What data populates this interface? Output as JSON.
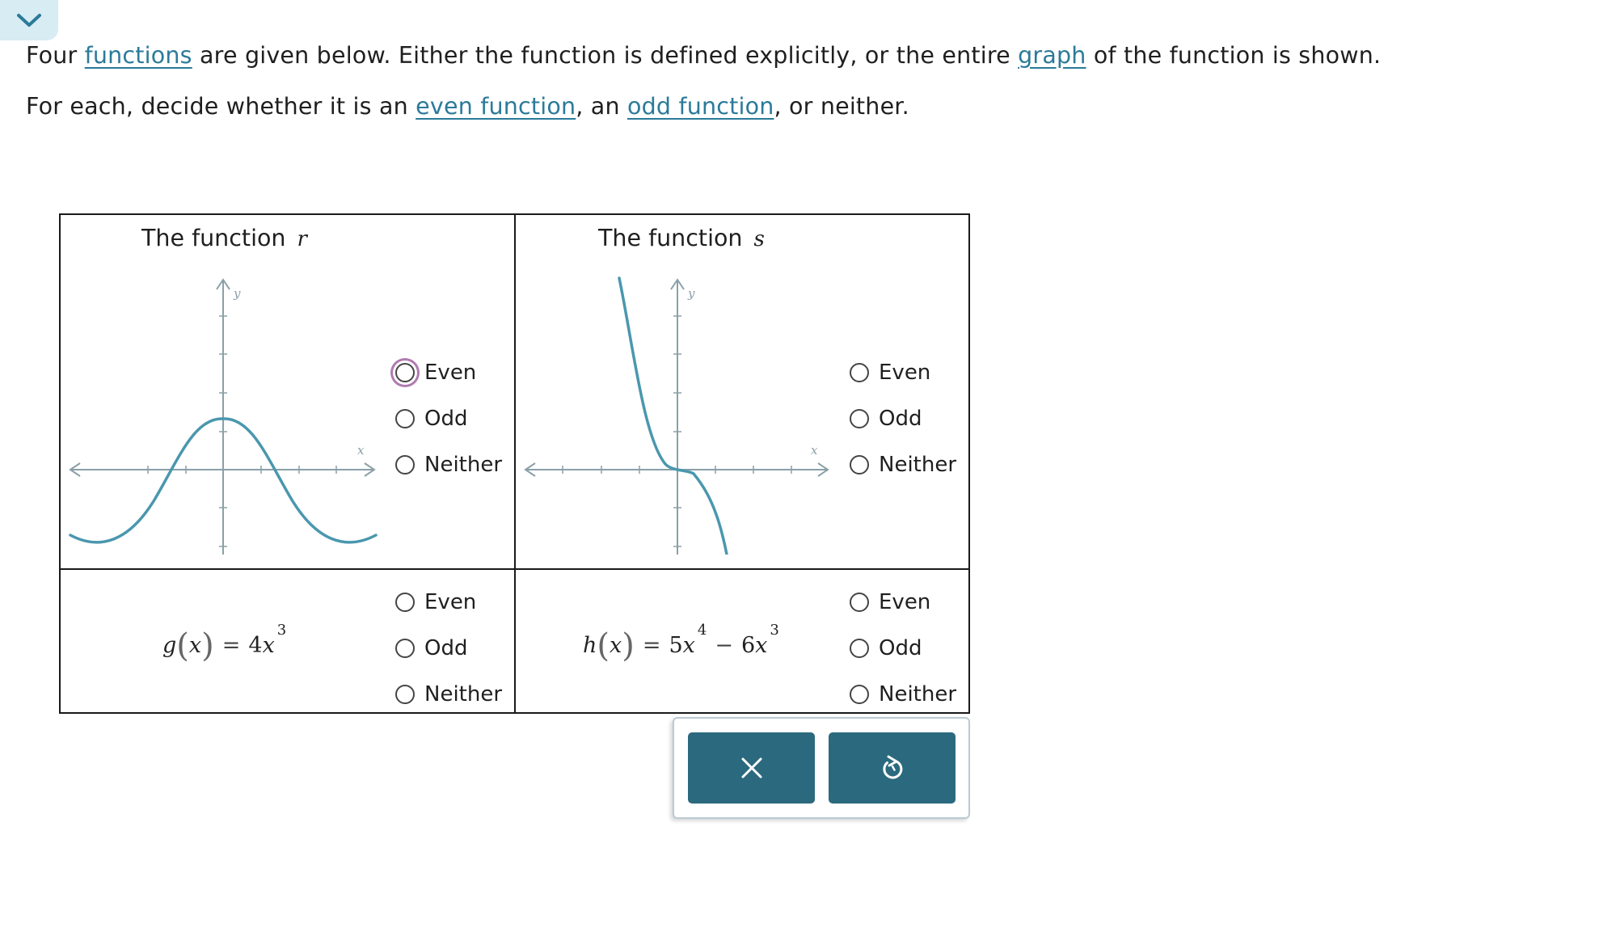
{
  "intro": {
    "line1": {
      "t1": "Four ",
      "link_functions": "functions",
      "t2": " are given below. Either the function is defined explicitly, or the entire ",
      "link_graph": "graph",
      "t3": " of the function is shown."
    },
    "line2": {
      "t1": "For each, decide whether it is an ",
      "link_even": "even function",
      "t2": ", an ",
      "link_odd": "odd function",
      "t3": ", or neither."
    }
  },
  "cells": [
    {
      "title": "The function",
      "var": "r",
      "graph": {
        "x_label": "x",
        "y_label": "y",
        "shape": "wave-peak-at-origin"
      },
      "options": [
        "Even",
        "Odd",
        "Neither"
      ]
    },
    {
      "title": "The function",
      "var": "s",
      "graph": {
        "x_label": "x",
        "y_label": "y",
        "shape": "decreasing-cubic"
      },
      "options": [
        "Even",
        "Odd",
        "Neither"
      ]
    },
    {
      "formula": {
        "name": "g",
        "arg": "x",
        "eq": "=",
        "term1_coef": "4",
        "term1_var": "x",
        "term1_exp": "3"
      },
      "options": [
        "Even",
        "Odd",
        "Neither"
      ]
    },
    {
      "formula": {
        "name": "h",
        "arg": "x",
        "eq": "=",
        "term1_coef": "5",
        "term1_var": "x",
        "term1_exp": "4",
        "minus": "−",
        "term2_coef": "6",
        "term2_var": "x",
        "term2_exp": "3"
      },
      "options": [
        "Even",
        "Odd",
        "Neither"
      ]
    }
  ],
  "actions": {
    "clear_icon": "x-icon",
    "reset_icon": "undo-icon"
  },
  "colors": {
    "accent": "#2b7a99",
    "button": "#2b6a7e",
    "curve": "#4a97ae",
    "axis": "#8aa0a8",
    "focus": "#b07ab0"
  }
}
